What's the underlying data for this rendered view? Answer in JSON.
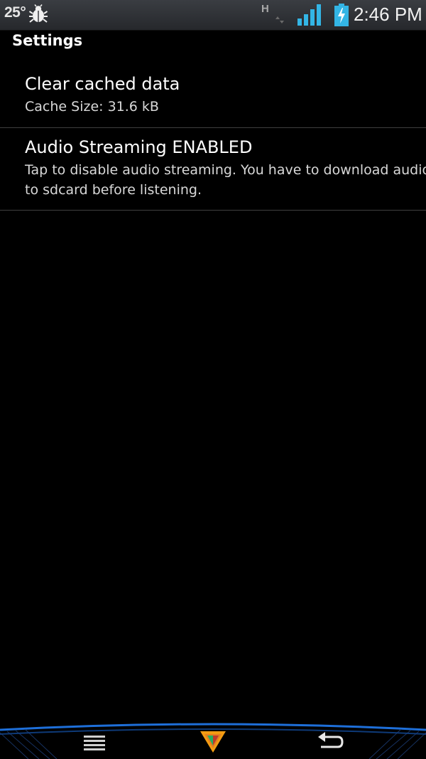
{
  "status_bar": {
    "temperature": "25°",
    "network_type": "H",
    "time": "2:46 PM",
    "icons": [
      "bug-icon",
      "h-network-icon",
      "signal-icon",
      "battery-charging-icon"
    ],
    "accent_color": "#33b5e5"
  },
  "page": {
    "title": "Settings"
  },
  "preferences": [
    {
      "title": "Clear cached data",
      "summary": "Cache Size: 31.6 kB"
    },
    {
      "title": "Audio Streaming ENABLED",
      "summary": "Tap to disable audio streaming. You have to download audio to sdcard before listening."
    }
  ],
  "nav_bar": {
    "icons": [
      "menu-icon",
      "home-logo-icon",
      "back-icon"
    ],
    "accent_color": "#1e6fd9"
  }
}
